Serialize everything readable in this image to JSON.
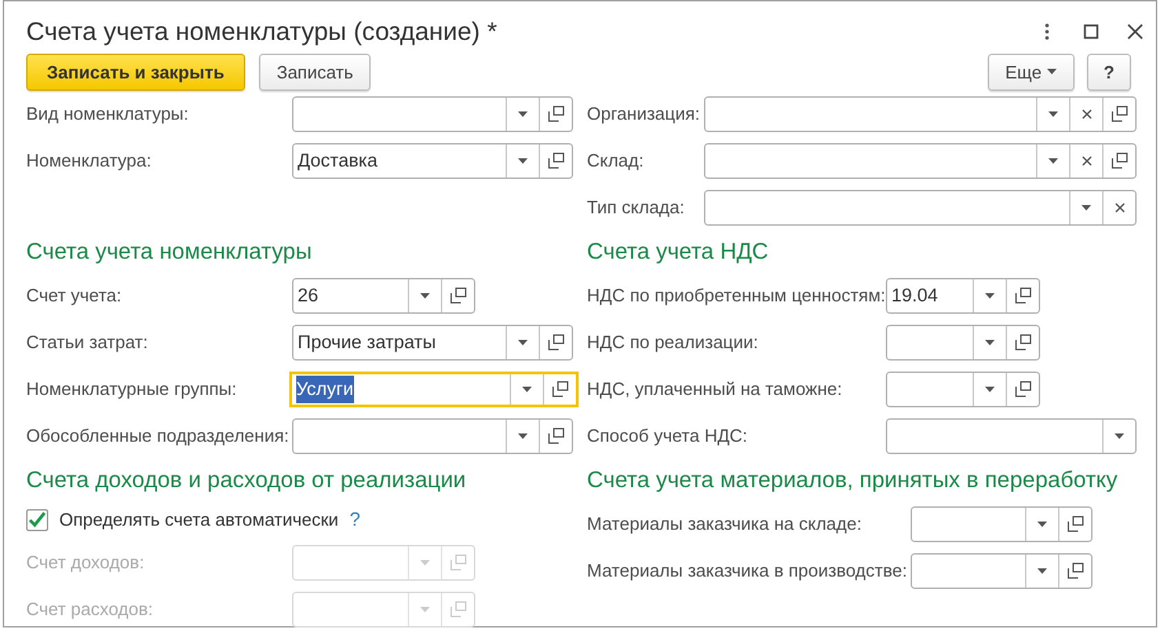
{
  "window": {
    "title": "Счета учета номенклатуры (создание) *"
  },
  "toolbar": {
    "buttons": [
      {
        "label": "Записать и закрыть",
        "kind": "primary"
      },
      {
        "label": "Записать",
        "kind": "default"
      }
    ],
    "more": {
      "label": "Еще"
    },
    "help": {
      "label": "?"
    }
  },
  "form_rows": [
    {
      "left": {
        "fields": [
          {
            "kind": "field",
            "label": "Вид номенклатуры:",
            "dropdown": true,
            "clear": false,
            "open": true,
            "disabled": false,
            "focused": false
          },
          {
            "kind": "field",
            "label": "Номенклатура:",
            "value": "Доставка",
            "dropdown": true,
            "clear": false,
            "open": true,
            "disabled": false,
            "focused": false
          }
        ]
      },
      "right": {
        "fields": [
          {
            "kind": "field",
            "label": "Организация:",
            "dropdown": true,
            "clear": true,
            "open": true,
            "disabled": false,
            "focused": false
          },
          {
            "kind": "field",
            "label": "Склад:",
            "dropdown": true,
            "clear": true,
            "open": true,
            "disabled": false,
            "focused": false
          },
          {
            "kind": "field",
            "label": "Тип склада:",
            "dropdown": true,
            "clear": true,
            "open": false,
            "disabled": false,
            "focused": false
          }
        ]
      }
    },
    {
      "left": {
        "title": "Счета учета номенклатуры",
        "fields": [
          {
            "kind": "field",
            "label": "Счет учета:",
            "value": "26",
            "dropdown": true,
            "clear": false,
            "open": true,
            "disabled": false,
            "focused": false
          },
          {
            "kind": "field",
            "label": "Статьи затрат:",
            "value": "Прочие затраты",
            "dropdown": true,
            "clear": false,
            "open": true,
            "disabled": false,
            "focused": false
          },
          {
            "kind": "field",
            "label": "Номенклатурные группы:",
            "value": "Услуги",
            "dropdown": true,
            "clear": false,
            "open": true,
            "disabled": false,
            "focused": true
          },
          {
            "kind": "field",
            "label": "Обособленные подразделения:",
            "dropdown": true,
            "clear": false,
            "open": true,
            "disabled": false,
            "focused": false
          }
        ]
      },
      "right": {
        "title": "Счета учета НДС",
        "fields": [
          {
            "kind": "field",
            "label": "НДС по приобретенным ценностям:",
            "value": "19.04",
            "dropdown": true,
            "clear": false,
            "open": true,
            "disabled": false,
            "focused": false
          },
          {
            "kind": "field",
            "label": "НДС по реализации:",
            "dropdown": true,
            "clear": false,
            "open": true,
            "disabled": false,
            "focused": false
          },
          {
            "kind": "field",
            "label": "НДС, уплаченный на таможне:",
            "dropdown": true,
            "clear": false,
            "open": true,
            "disabled": false,
            "focused": false
          },
          {
            "kind": "field",
            "label": "Способ учета НДС:",
            "dropdown": true,
            "clear": false,
            "open": false,
            "disabled": false,
            "focused": false
          }
        ]
      }
    },
    {
      "left": {
        "title": "Счета доходов и расходов от реализации",
        "fields": [
          {
            "kind": "checkbox",
            "label": "Определять счета автоматически",
            "checked": true,
            "help": "?"
          },
          {
            "kind": "field",
            "label": "Счет доходов:",
            "dropdown": true,
            "clear": false,
            "open": true,
            "disabled": true,
            "focused": false
          },
          {
            "kind": "field",
            "label": "Счет расходов:",
            "dropdown": true,
            "clear": false,
            "open": true,
            "disabled": true,
            "focused": false
          }
        ]
      },
      "right": {
        "title": "Счета учета материалов, принятых в переработку",
        "fields": [
          {
            "kind": "field",
            "label": "Материалы заказчика на складе:",
            "dropdown": true,
            "clear": false,
            "open": true,
            "disabled": false,
            "focused": false
          },
          {
            "kind": "field",
            "label": "Материалы заказчика в производстве:",
            "dropdown": true,
            "clear": false,
            "open": true,
            "disabled": false,
            "focused": false
          }
        ]
      }
    }
  ]
}
